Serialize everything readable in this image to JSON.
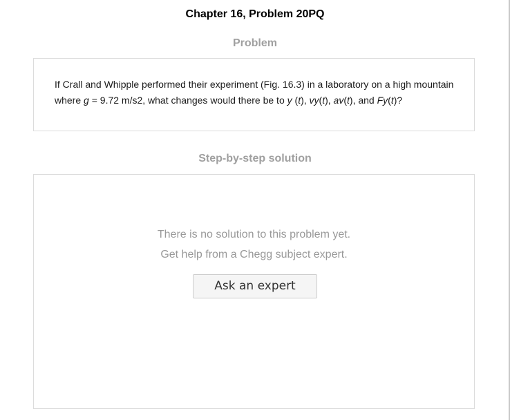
{
  "header": {
    "title": "Chapter 16, Problem 20PQ"
  },
  "problem": {
    "heading": "Problem",
    "text_parts": {
      "p1": "If Crall and Whipple performed their experiment (Fig. 16.3) in a laboratory on a high mountain where ",
      "g": "g",
      "p2": " = 9.72 m/s2, what changes would there be to ",
      "y": "y",
      "p3": " (",
      "t1": "t",
      "p4": "), ",
      "vy": "vy",
      "p5": "(",
      "t2": "t",
      "p6": "), ",
      "av": "av",
      "p7": "(",
      "t3": "t",
      "p8": "), and ",
      "fy": "Fy",
      "p9": "(",
      "t4": "t",
      "p10": ")?"
    }
  },
  "solution": {
    "heading": "Step-by-step solution",
    "message_line1": "There is no solution to this problem yet.",
    "message_line2": "Get help from a Chegg subject expert.",
    "ask_button_label": "Ask an expert"
  }
}
